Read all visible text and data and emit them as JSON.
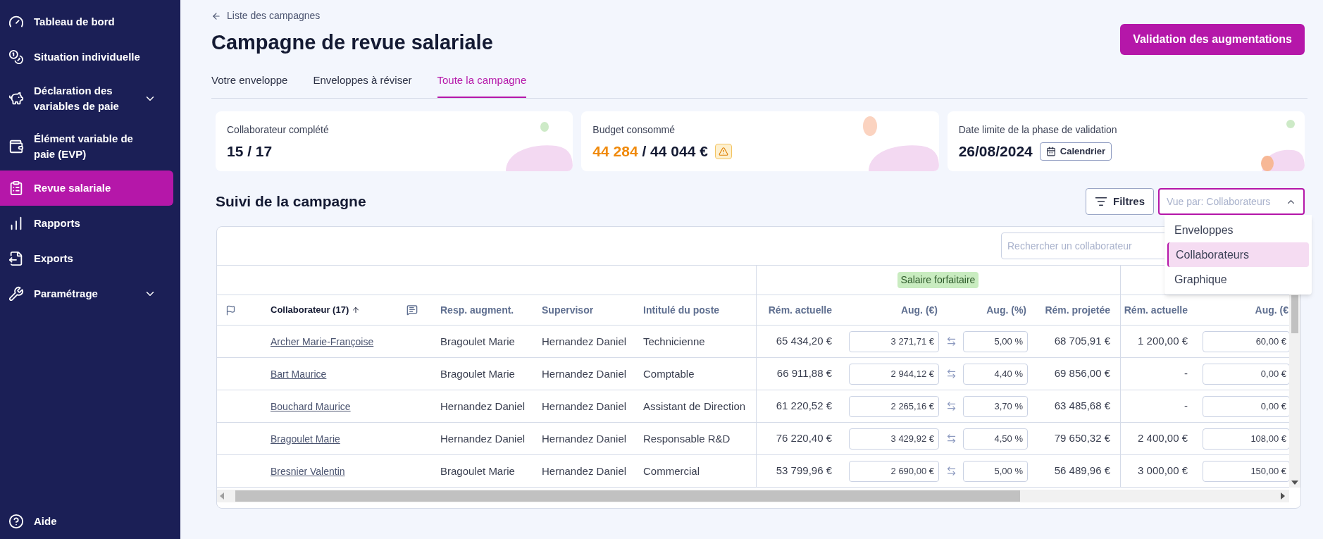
{
  "sidebar": {
    "items": [
      {
        "label": "Tableau de bord",
        "selected": false,
        "has_submenu": false
      },
      {
        "label": "Situation individuelle",
        "selected": false,
        "has_submenu": false
      },
      {
        "label": "Déclaration des variables de paie",
        "selected": false,
        "has_submenu": true
      },
      {
        "label": "Élément variable de paie (EVP)",
        "selected": false,
        "has_submenu": false
      },
      {
        "label": "Revue salariale",
        "selected": true,
        "has_submenu": false
      },
      {
        "label": "Rapports",
        "selected": false,
        "has_submenu": false
      },
      {
        "label": "Exports",
        "selected": false,
        "has_submenu": false
      },
      {
        "label": "Paramétrage",
        "selected": false,
        "has_submenu": true
      }
    ],
    "footer": "Aide"
  },
  "breadcrumb": "Liste des campagnes",
  "title": "Campagne de revue salariale",
  "primary_button": "Validation des augmentations",
  "tabs": [
    {
      "label": "Votre enveloppe",
      "selected": false
    },
    {
      "label": "Enveloppes à réviser",
      "selected": false
    },
    {
      "label": "Toute la campagne",
      "selected": true
    }
  ],
  "cards": [
    {
      "label": "Collaborateur complété",
      "value": "15 / 17"
    },
    {
      "label": "Budget consommé",
      "consumed": "44 284",
      "value": "/ 44 044 €",
      "warning": true
    },
    {
      "label": "Date limite de la phase de validation",
      "value": "26/08/2024",
      "button": "Calendrier"
    }
  ],
  "section_title": "Suivi de la campagne",
  "filters_button": "Filtres",
  "view_select": {
    "value": "Vue par: Collaborateurs",
    "open": true,
    "options": [
      {
        "label": "Enveloppes",
        "selected": false
      },
      {
        "label": "Collaborateurs",
        "selected": true
      },
      {
        "label": "Graphique",
        "selected": false
      }
    ]
  },
  "search": {
    "placeholder": "Rechercher un collaborateur"
  },
  "table": {
    "group_header": "Salaire forfaitaire",
    "columns": [
      {
        "label": "Collaborateur (17)",
        "sorted_ascending": true
      },
      {
        "label": "Resp. augment."
      },
      {
        "label": "Supervisor"
      },
      {
        "label": "Intitulé du poste"
      },
      {
        "label": "Rém. actuelle"
      },
      {
        "label": "Aug. (€)"
      },
      {
        "label": "Aug. (%)"
      },
      {
        "label": "Rém. projetée"
      },
      {
        "label": "Rém. actuelle"
      },
      {
        "label": "Aug. (€"
      }
    ],
    "rows": [
      {
        "name": "Archer Marie-Françoise",
        "resp": "Bragoulet Marie",
        "supervisor": "Hernandez Daniel",
        "job": "Technicienne",
        "rem": "65 434,20 €",
        "aug_eur": "3 271,71 €",
        "aug_pct": "5,00 %",
        "projected": "68 705,91 €",
        "rem_2": "1 200,00 €",
        "aug_eur_2": "60,00 €"
      },
      {
        "name": "Bart Maurice",
        "resp": "Bragoulet Marie",
        "supervisor": "Hernandez Daniel",
        "job": "Comptable",
        "rem": "66 911,88 €",
        "aug_eur": "2 944,12 €",
        "aug_pct": "4,40 %",
        "projected": "69 856,00 €",
        "rem_2": "-",
        "aug_eur_2": "0,00 €"
      },
      {
        "name": "Bouchard Maurice",
        "resp": "Hernandez Daniel",
        "supervisor": "Hernandez Daniel",
        "job": "Assistant de Direction",
        "rem": "61 220,52 €",
        "aug_eur": "2 265,16 €",
        "aug_pct": "3,70 %",
        "projected": "63 485,68 €",
        "rem_2": "-",
        "aug_eur_2": "0,00 €"
      },
      {
        "name": "Bragoulet Marie",
        "resp": "Hernandez Daniel",
        "supervisor": "Hernandez Daniel",
        "job": "Responsable R&D",
        "rem": "76 220,40 €",
        "aug_eur": "3 429,92 €",
        "aug_pct": "4,50 %",
        "projected": "79 650,32 €",
        "rem_2": "2 400,00 €",
        "aug_eur_2": "108,00 €"
      },
      {
        "name": "Bresnier Valentin",
        "resp": "Bragoulet Marie",
        "supervisor": "Hernandez Daniel",
        "job": "Commercial",
        "rem": "53 799,96 €",
        "aug_eur": "2 690,00 €",
        "aug_pct": "5,00 %",
        "projected": "56 489,96 €",
        "rem_2": "3 000,00 €",
        "aug_eur_2": "150,00 €"
      }
    ]
  }
}
